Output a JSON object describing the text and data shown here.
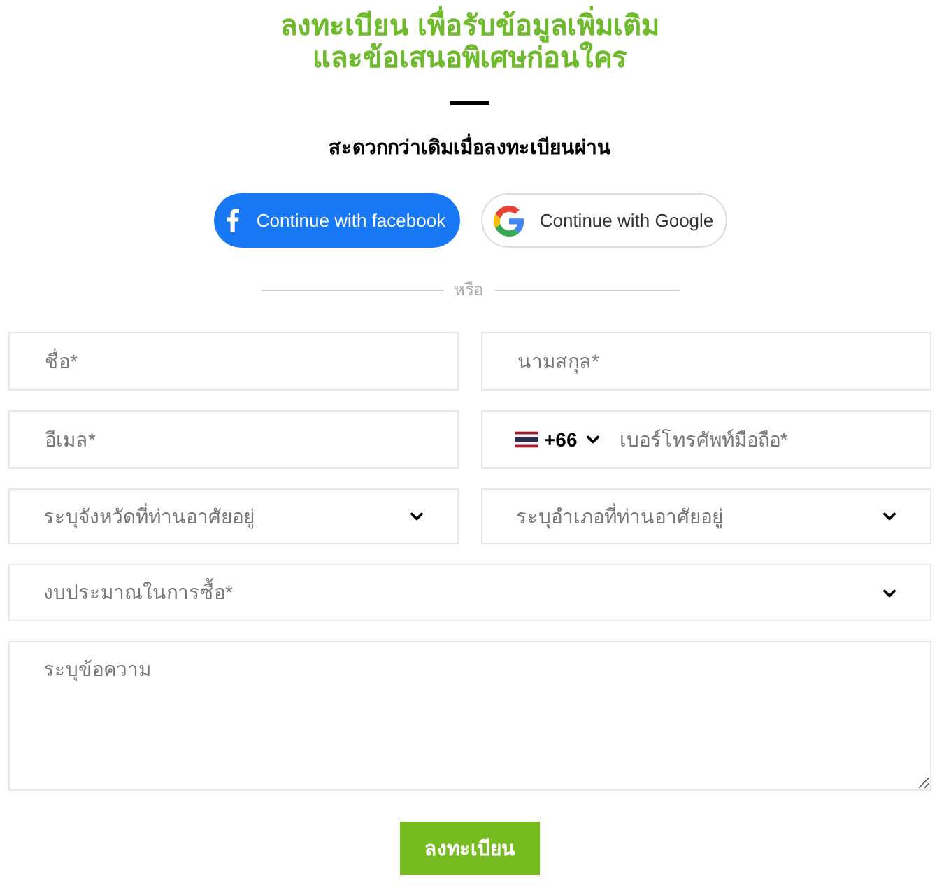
{
  "header": {
    "title_lines": [
      "ลงทะเบียน เพื่อรับข้อมูลเพิ่มเติม",
      "และข้อเสนอพิเศษก่อนใคร"
    ],
    "subtitle": "สะดวกกว่าเดิมเมื่อลงทะเบียนผ่าน"
  },
  "social_buttons": [
    {
      "kind": "facebook",
      "label": "Continue with facebook"
    },
    {
      "kind": "google",
      "label": "Continue with Google"
    }
  ],
  "divider": {
    "label": "หรือ"
  },
  "fields": [
    {
      "kind": "text",
      "placeholder": "ชื่อ*"
    },
    {
      "kind": "text",
      "placeholder": "นามสกุล*"
    },
    {
      "kind": "text",
      "placeholder": "อีเมล*"
    },
    {
      "kind": "phone",
      "country_code": "+66",
      "placeholder": "เบอร์โทรศัพท์มือถือ*"
    },
    {
      "kind": "select",
      "placeholder": "ระบุจังหวัดที่ท่านอาศัยอยู่"
    },
    {
      "kind": "select",
      "placeholder": "ระบุอำเภอที่ท่านอาศัยอยู่"
    },
    {
      "kind": "select",
      "placeholder": "งบประมาณในการซื้อ*",
      "wide": true
    },
    {
      "kind": "textarea",
      "placeholder": "ระบุข้อความ"
    }
  ],
  "submit_button": {
    "label": "ลงทะเบียน"
  }
}
